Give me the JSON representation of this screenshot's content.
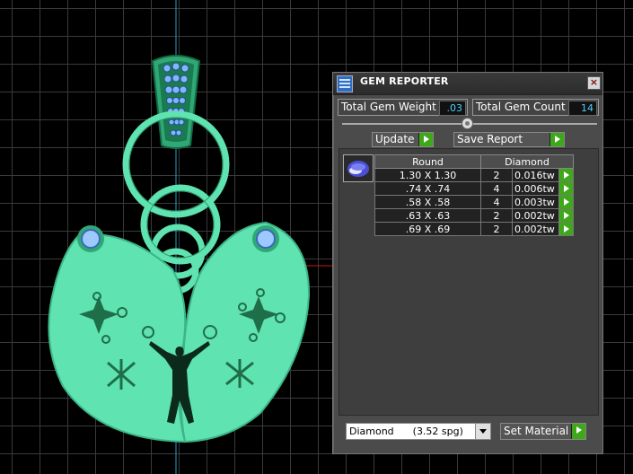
{
  "panel": {
    "title": "GEM REPORTER",
    "close_glyph": "×",
    "total_gem_weight_label": "Total Gem Weight",
    "total_gem_weight_value": ".03",
    "total_gem_count_label": "Total Gem Count",
    "total_gem_count_value": "14",
    "update_label": "Update",
    "save_report_label": "Save Report",
    "table": {
      "headers": [
        "Round",
        "Diamond"
      ],
      "rows": [
        {
          "size": "1.30 X 1.30",
          "qty": "2",
          "weight": "0.016tw"
        },
        {
          "size": ".74 X .74",
          "qty": "4",
          "weight": "0.006tw"
        },
        {
          "size": ".58 X .58",
          "qty": "4",
          "weight": "0.003tw"
        },
        {
          "size": ".63 X .63",
          "qty": "2",
          "weight": "0.002tw"
        },
        {
          "size": ".69 X .69",
          "qty": "2",
          "weight": "0.002tw"
        }
      ]
    },
    "material_select": "Diamond      (3.52 spg)",
    "set_material_label": "Set Material"
  },
  "colors": {
    "model": "#5fe3b0",
    "model_dark": "#1f8a5c",
    "accent": "#3fa71a",
    "value_text": "#4fd0ff"
  }
}
